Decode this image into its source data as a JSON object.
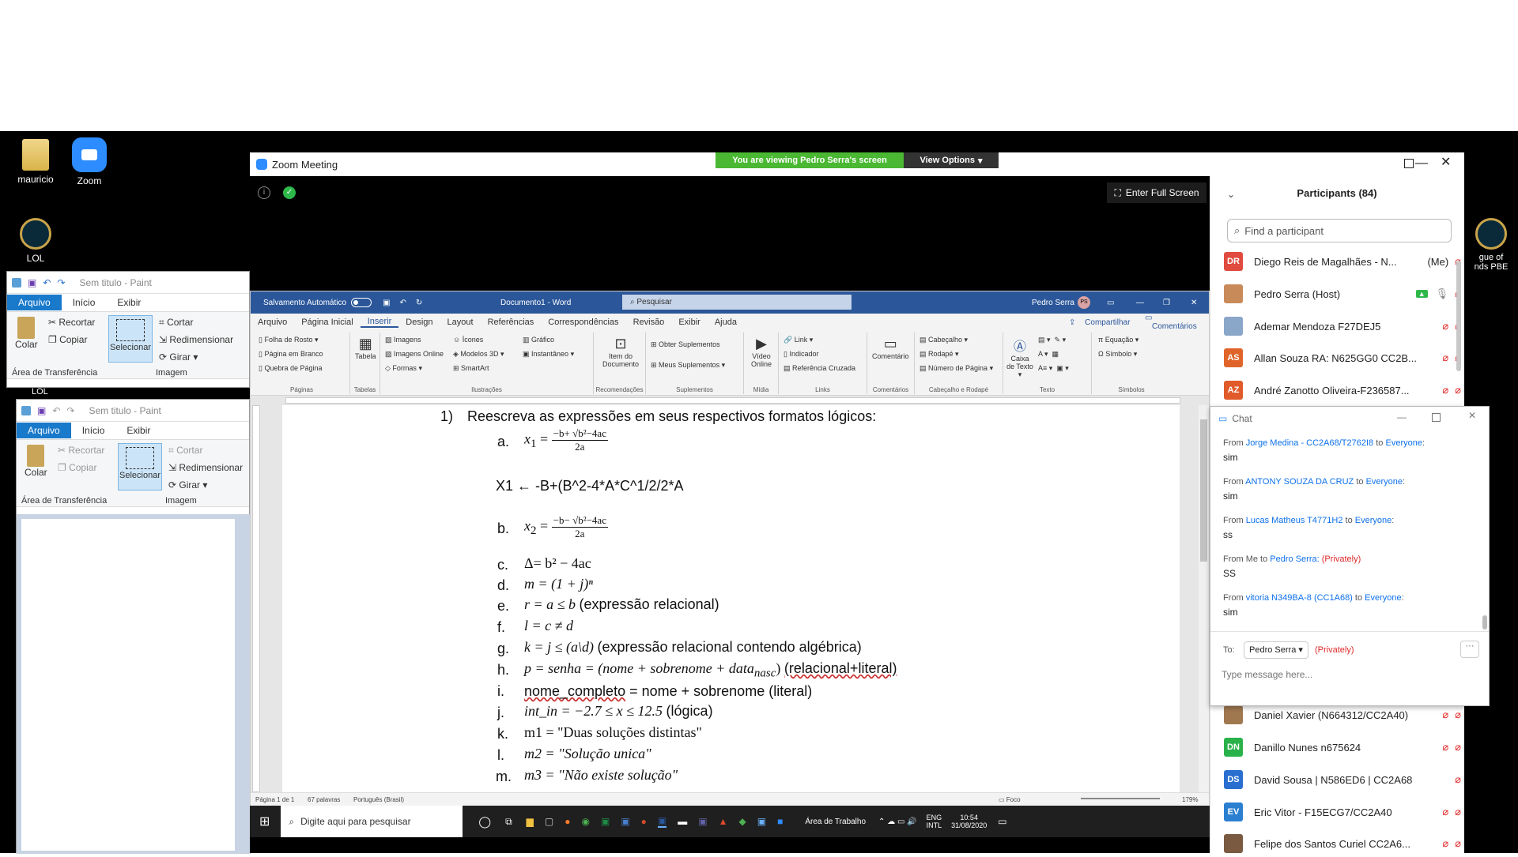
{
  "desktop": {
    "icons": [
      {
        "label": "mauricio"
      },
      {
        "label": "Zoom"
      },
      {
        "label": "LOL"
      }
    ],
    "right_icon_label": "gue of\nnds PBE"
  },
  "paint1": {
    "title": "Sem titulo - Paint",
    "tabs": [
      "Arquivo",
      "Início",
      "Exibir"
    ],
    "colar": "Colar",
    "recortar": "Recortar",
    "copiar": "Copiar",
    "selecionar": "Selecionar",
    "cortar": "Cortar",
    "redimensionar": "Redimensionar",
    "girar": "Girar",
    "grp_area": "Área de Transferência",
    "grp_imagem": "Imagem",
    "lol": "LOL"
  },
  "paint2": {
    "title": "Sem titulo - Paint",
    "tabs": [
      "Arquivo",
      "Início",
      "Exibir"
    ],
    "colar": "Colar",
    "recortar": "Recortar",
    "copiar": "Copiar",
    "selecionar": "Selecionar",
    "cortar": "Cortar",
    "redimensionar": "Redimensionar",
    "girar": "Girar",
    "grp_area": "Área de Transferência",
    "grp_imagem": "Imagem"
  },
  "zoom": {
    "title": "Zoom Meeting",
    "banner": "You are viewing Pedro Serra's screen",
    "view_options": "View Options",
    "fullscreen": "Enter Full Screen"
  },
  "word": {
    "autosave": "Salvamento Automático",
    "doc_title": "Documento1 - Word",
    "search": "Pesquisar",
    "user": "Pedro Serra",
    "user_initials": "PS",
    "menu": [
      "Arquivo",
      "Página Inicial",
      "Inserir",
      "Design",
      "Layout",
      "Referências",
      "Correspondências",
      "Revisão",
      "Exibir",
      "Ajuda"
    ],
    "share": "Compartilhar",
    "comments": "Comentários",
    "ribbon": {
      "folha": "Folha de Rosto",
      "pagina_branco": "Página em Branco",
      "quebra": "Quebra de Página",
      "g_paginas": "Páginas",
      "tabela": "Tabela",
      "g_tabelas": "Tabelas",
      "imagens": "Imagens",
      "imagens_online": "Imagens Online",
      "formas": "Formas",
      "icones": "Ícones",
      "modelos3d": "Modelos 3D",
      "smartart": "SmartArt",
      "grafico": "Gráfico",
      "instantaneo": "Instantâneo",
      "g_ilustracoes": "Ilustrações",
      "item_doc": "Item do Documento",
      "g_recom": "Recomendações",
      "obter": "Obter Suplementos",
      "meus": "Meus Suplementos",
      "g_supl": "Suplementos",
      "video": "Vídeo Online",
      "g_midia": "Mídia",
      "link": "Link",
      "indicador": "Indicador",
      "ref_cruzada": "Referência Cruzada",
      "g_links": "Links",
      "comentario": "Comentário",
      "g_coment": "Comentários",
      "cabecalho": "Cabeçalho",
      "rodape": "Rodapé",
      "num_pagina": "Número de Página",
      "g_cab": "Cabeçalho e Rodapé",
      "caixa": "Caixa de Texto",
      "g_texto": "Texto",
      "equacao": "Equação",
      "simbolo": "Símbolo",
      "g_simb": "Símbolos"
    },
    "doc": {
      "q1": "1)",
      "q1_text": "Reescreva as expressões em seus respectivos formatos lógicos:",
      "a": "a.",
      "a_lhs": "x",
      "a_sub": "1",
      "a_num": "−b+ √b²−4ac",
      "a_den": "2a",
      "x1": "X1 ← -B+(B^2-4*A*C^1/2/2*A",
      "b": "b.",
      "b_lhs": "x",
      "b_sub": "2",
      "b_num": "−b− √b²−4ac",
      "b_den": "2a",
      "c": "c.",
      "c_expr": "Δ= b² − 4ac",
      "d": "d.",
      "d_expr": "m = (1 + j)ⁿ",
      "e": "e.",
      "e_expr": "r = a ≤ b",
      "e_note": "(expressão relacional)",
      "f": "f.",
      "f_expr": "l = c  ≠ d",
      "g": "g.",
      "g_expr": "k = j  ≤ (a\\d)",
      "g_note": "(expressão relacional contendo algébrica)",
      "h": "h.",
      "h_expr": "p = senha = (nome + sobrenome + data",
      "h_sub": "nasc",
      "h_close": ")",
      "h_note": "(relacional+literal)",
      "i": "i.",
      "i_var": "nome_completo",
      "i_rest": "= nome + sobrenome (literal)",
      "j": "j.",
      "j_expr": "int_in =  −2.7 ≤ x  ≤ 12.5",
      "j_note": "(lógica)",
      "k": "k.",
      "k_expr": "m1 = \"Duas soluções distintas\"",
      "l": "l.",
      "l_expr": "m2 = \"Solução unica\"",
      "m": "m.",
      "m_expr": "m3 = \"Não existe solução\""
    },
    "status": {
      "page": "Página 1 de 1",
      "words": "67 palavras",
      "lang": "Português (Brasil)",
      "focus": "Foco",
      "zoom": "179%"
    },
    "taskbar": {
      "search": "Digite aqui para pesquisar",
      "area": "Área de Trabalho",
      "lang1": "ENG",
      "lang2": "INTL",
      "time": "10:54",
      "date": "31/08/2020"
    }
  },
  "participants": {
    "title": "Participants (84)",
    "search": "Find a participant",
    "list": [
      {
        "initials": "DR",
        "name": "Diego Reis de Magalhães - N...",
        "tag": "(Me)",
        "color": "#e04a3f"
      },
      {
        "initials": "",
        "name": "Pedro Serra (Host)",
        "tag": "",
        "color": "#c98a5a"
      },
      {
        "initials": "",
        "name": "Ademar Mendoza F27DEJ5",
        "tag": "",
        "color": "#8aa6c9"
      },
      {
        "initials": "AS",
        "name": "Allan Souza RA: N625GG0 CC2B...",
        "tag": "",
        "color": "#e0642a"
      },
      {
        "initials": "AZ",
        "name": "André Zanotto Oliveira-F236587...",
        "tag": "",
        "color": "#e05a2a"
      },
      {
        "initials": "",
        "name": "Daniel Xavier (N664312/CC2A40)",
        "tag": "",
        "color": "#a07850"
      },
      {
        "initials": "DN",
        "name": "Danillo Nunes n675624",
        "tag": "",
        "color": "#2ab24a"
      },
      {
        "initials": "DS",
        "name": "David Sousa | N586ED6 | CC2A68",
        "tag": "",
        "color": "#2a6fd0"
      },
      {
        "initials": "EV",
        "name": "Eric Vitor - F15ECG7/CC2A40",
        "tag": "",
        "color": "#2a7fd0"
      },
      {
        "initials": "",
        "name": "Felipe dos Santos Curiel CC2A6...",
        "tag": "",
        "color": "#7a5a40"
      }
    ]
  },
  "chat": {
    "title": "Chat",
    "messages": [
      {
        "from": "Jorge Medina - CC2A68/T2762I8",
        "to": "Everyone",
        "text": "sim",
        "private": ""
      },
      {
        "from": "ANTONY SOUZA DA CRUZ",
        "to": "Everyone",
        "text": "sim",
        "private": ""
      },
      {
        "from": "Lucas Matheus T4771H2",
        "to": "Everyone",
        "text": "ss",
        "private": ""
      },
      {
        "from": "Pedro Serra:",
        "to": "",
        "text": "SS",
        "private": "(Privately)"
      },
      {
        "from": "vitoria N349BA-8 (CC1A68)",
        "to": "Everyone",
        "text": "sim",
        "private": ""
      }
    ],
    "from_prefix": "From",
    "from_me": "From Me to",
    "to_word": "to",
    "to_label": "To:",
    "to_value": "Pedro Serra",
    "to_private": "(Privately)",
    "placeholder": "Type message here..."
  }
}
